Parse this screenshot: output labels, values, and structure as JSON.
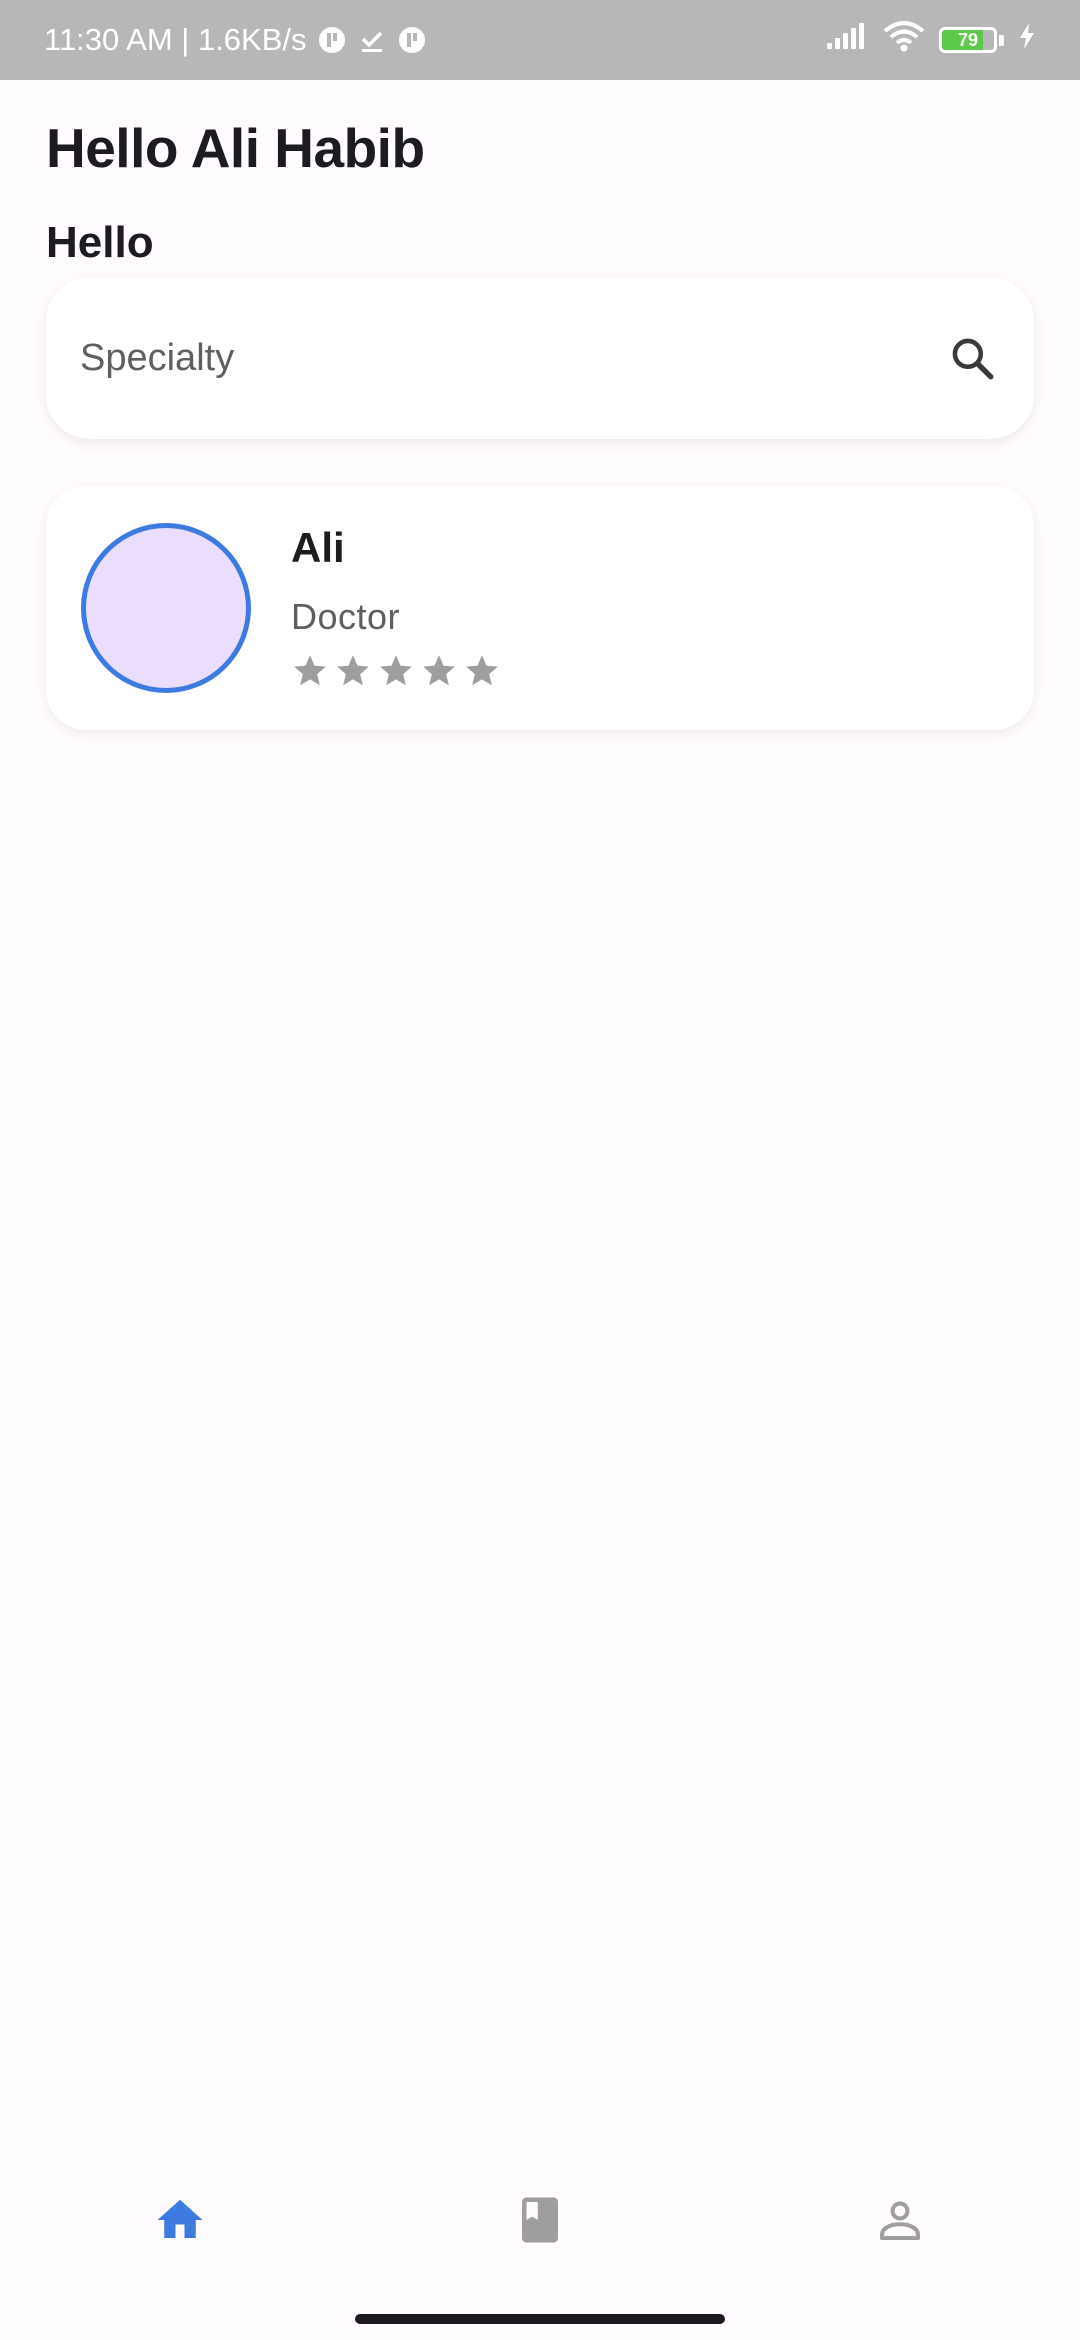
{
  "status_bar": {
    "time_text": "11:30 AM | 1.6KB/s",
    "battery_level": "79",
    "battery_fraction": 0.79,
    "icons": [
      "notification-app-icon",
      "download-done-icon",
      "notification-app-icon",
      "signal-icon",
      "wifi-icon",
      "battery-icon",
      "charging-icon"
    ]
  },
  "header": {
    "greeting": "Hello Ali Habib",
    "subgreeting": "Hello"
  },
  "search": {
    "placeholder": "Specialty",
    "value": "",
    "icon": "search-icon"
  },
  "doctors": [
    {
      "name": "Ali",
      "role": "Doctor",
      "rating": 0,
      "max_rating": 5
    }
  ],
  "bottom_nav": {
    "items": [
      {
        "icon": "home-icon",
        "active": true
      },
      {
        "icon": "book-icon",
        "active": false
      },
      {
        "icon": "profile-icon",
        "active": false
      }
    ],
    "active_color": "#3D7BE0",
    "inactive_color": "#9E9E9E"
  },
  "colors": {
    "background": "#FFFBFE",
    "status_bar": "#B7B6B8",
    "accent": "#3D7BE0",
    "avatar_fill": "#EADDFF",
    "star_inactive": "#9E9E9E"
  }
}
